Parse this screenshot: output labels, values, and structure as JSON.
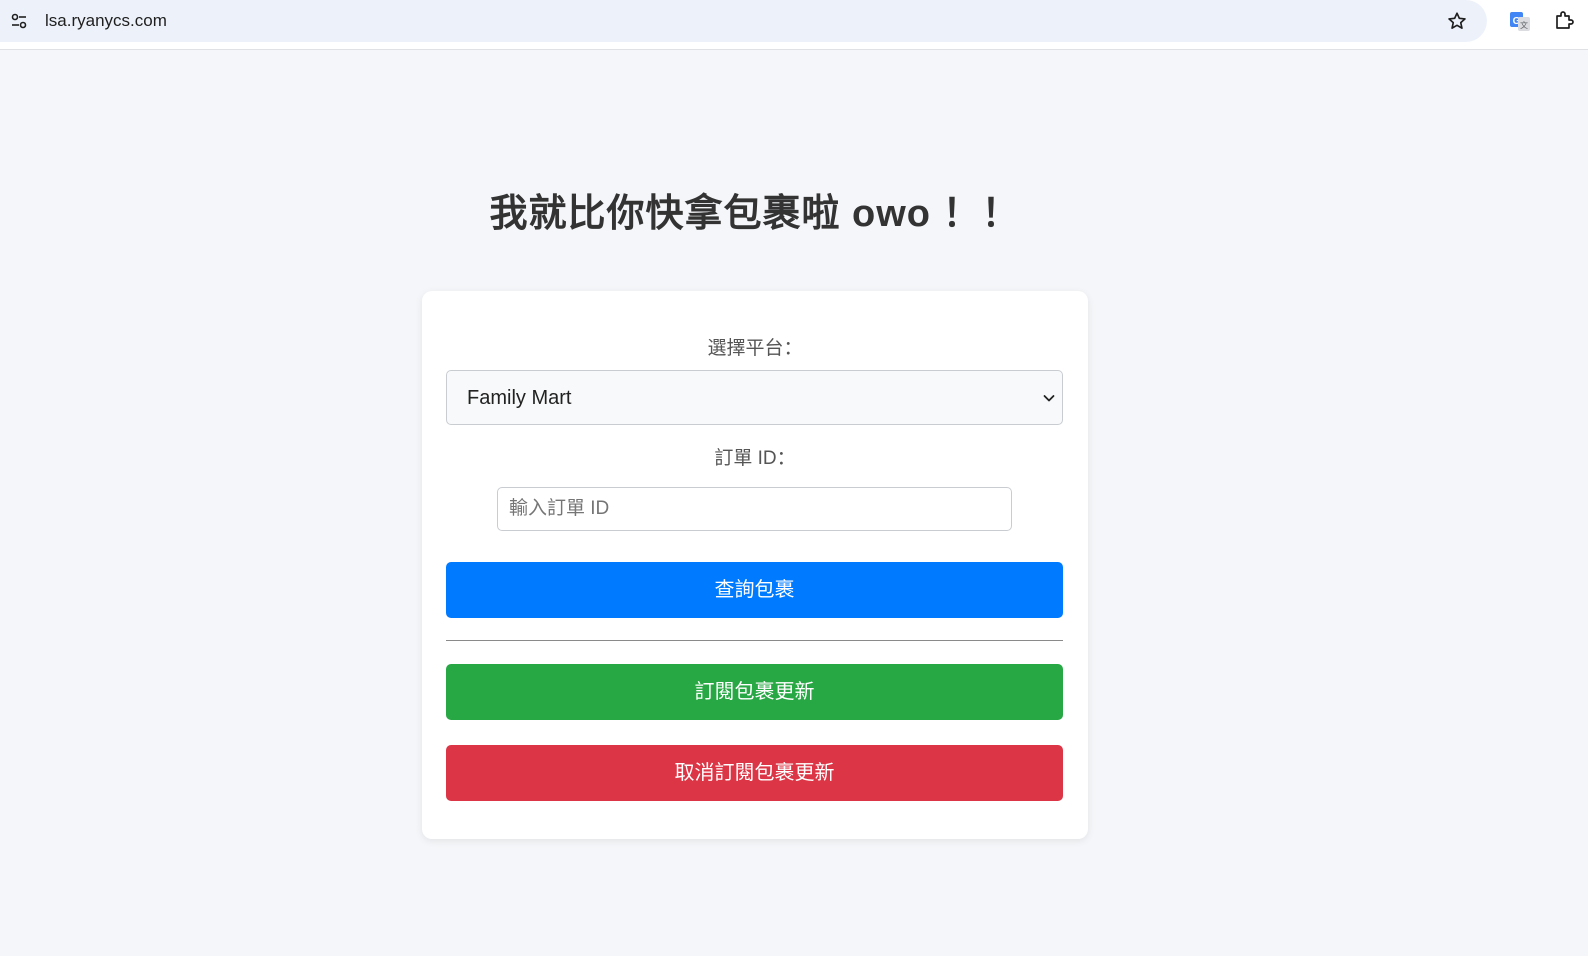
{
  "browser": {
    "url": "lsa.ryanycs.com",
    "icons": [
      "site-info-icon",
      "star-icon",
      "translate-icon",
      "extension-icon"
    ]
  },
  "page": {
    "title": "我就比你快拿包裹啦 owo ！！"
  },
  "form": {
    "platform_label": "選擇平台：",
    "platform_selected": "Family Mart",
    "order_label": "訂單 ID：",
    "order_placeholder": "輸入訂單 ID",
    "order_value": ""
  },
  "buttons": {
    "query": "查詢包裹",
    "subscribe": "訂閱包裹更新",
    "unsubscribe": "取消訂閱包裹更新"
  },
  "colors": {
    "background": "#f4f6f9",
    "query": "#007bff",
    "subscribe": "#28a745",
    "unsubscribe": "#dc3545"
  }
}
